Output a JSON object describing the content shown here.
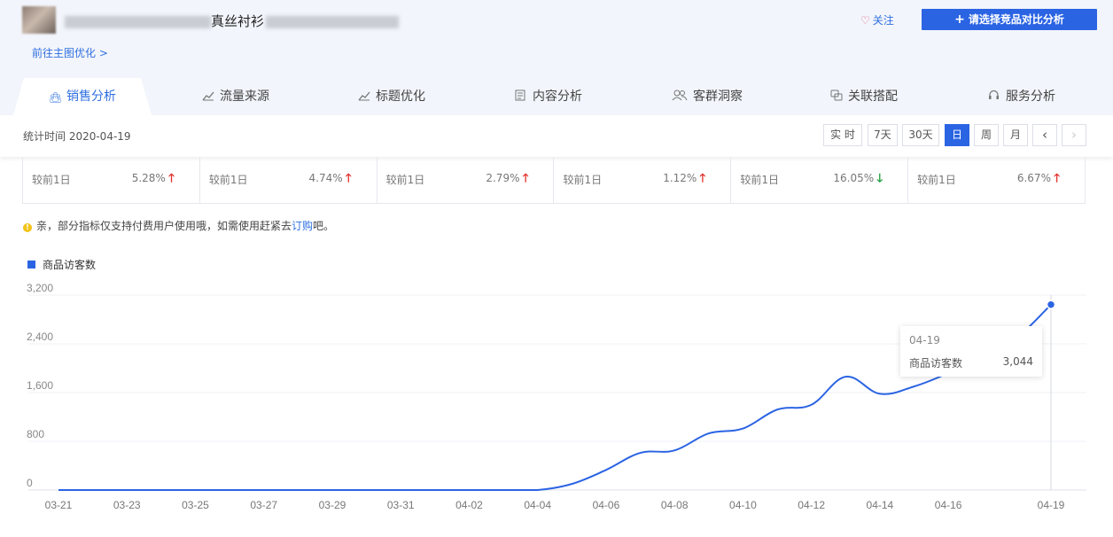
{
  "product": {
    "title_visible": "真丝衬衫"
  },
  "header": {
    "follow_label": "关注",
    "compare_label": "请选择竞品对比分析",
    "goto_label": "前往主图优化 >"
  },
  "tabs": [
    {
      "label": "销售分析",
      "icon": "bag-icon",
      "active": true
    },
    {
      "label": "流量来源",
      "icon": "line-chart-icon"
    },
    {
      "label": "标题优化",
      "icon": "line-chart-icon"
    },
    {
      "label": "内容分析",
      "icon": "document-icon"
    },
    {
      "label": "客群洞察",
      "icon": "users-icon"
    },
    {
      "label": "关联搭配",
      "icon": "link-icon"
    },
    {
      "label": "服务分析",
      "icon": "headset-icon"
    }
  ],
  "toolbar": {
    "stat_time": "统计时间 2020-04-19",
    "ranges": [
      "实 时",
      "7天",
      "30天",
      "日",
      "周",
      "月"
    ],
    "active_range": "日",
    "prev": "‹",
    "next": "›"
  },
  "metrics": [
    {
      "label": "较前1日",
      "value": "5.28%",
      "dir": "up"
    },
    {
      "label": "较前1日",
      "value": "4.74%",
      "dir": "up"
    },
    {
      "label": "较前1日",
      "value": "2.79%",
      "dir": "up"
    },
    {
      "label": "较前1日",
      "value": "1.12%",
      "dir": "up"
    },
    {
      "label": "较前1日",
      "value": "16.05%",
      "dir": "down"
    },
    {
      "label": "较前1日",
      "value": "6.67%",
      "dir": "up"
    }
  ],
  "notice": {
    "text": "亲，部分指标仅支持付费用户使用哦，如需使用赶紧去",
    "link": "订购",
    "suffix": "吧。"
  },
  "colors": {
    "accent": "#2b64e3",
    "up": "#e2312c",
    "down": "#1a9e3a"
  },
  "chart_data": {
    "type": "line",
    "series": [
      {
        "name": "商品访客数",
        "x": [
          "03-21",
          "03-22",
          "03-23",
          "03-24",
          "03-25",
          "03-26",
          "03-27",
          "03-28",
          "03-29",
          "03-30",
          "03-31",
          "04-01",
          "04-02",
          "04-03",
          "04-04",
          "04-05",
          "04-06",
          "04-07",
          "04-08",
          "04-09",
          "04-10",
          "04-11",
          "04-12",
          "04-13",
          "04-14",
          "04-15",
          "04-16",
          "04-17",
          "04-18",
          "04-19"
        ],
        "values": [
          0,
          0,
          0,
          0,
          0,
          0,
          0,
          0,
          0,
          0,
          0,
          0,
          0,
          0,
          0,
          100,
          330,
          610,
          650,
          930,
          1010,
          1320,
          1400,
          1860,
          1580,
          1700,
          1920,
          2200,
          2500,
          3044
        ]
      }
    ],
    "x_tick_labels": [
      "03-21",
      "03-23",
      "03-25",
      "03-27",
      "03-29",
      "03-31",
      "04-02",
      "04-04",
      "04-06",
      "04-08",
      "04-10",
      "04-12",
      "04-14",
      "04-16",
      "04-19"
    ],
    "y_ticks": [
      "3,200",
      "2,400",
      "1,600",
      "800",
      "0"
    ],
    "ylim": [
      0,
      3200
    ],
    "grid": true,
    "legend": "top-left",
    "tooltip": {
      "date": "04-19",
      "name": "商品访客数",
      "value": "3,044"
    }
  }
}
